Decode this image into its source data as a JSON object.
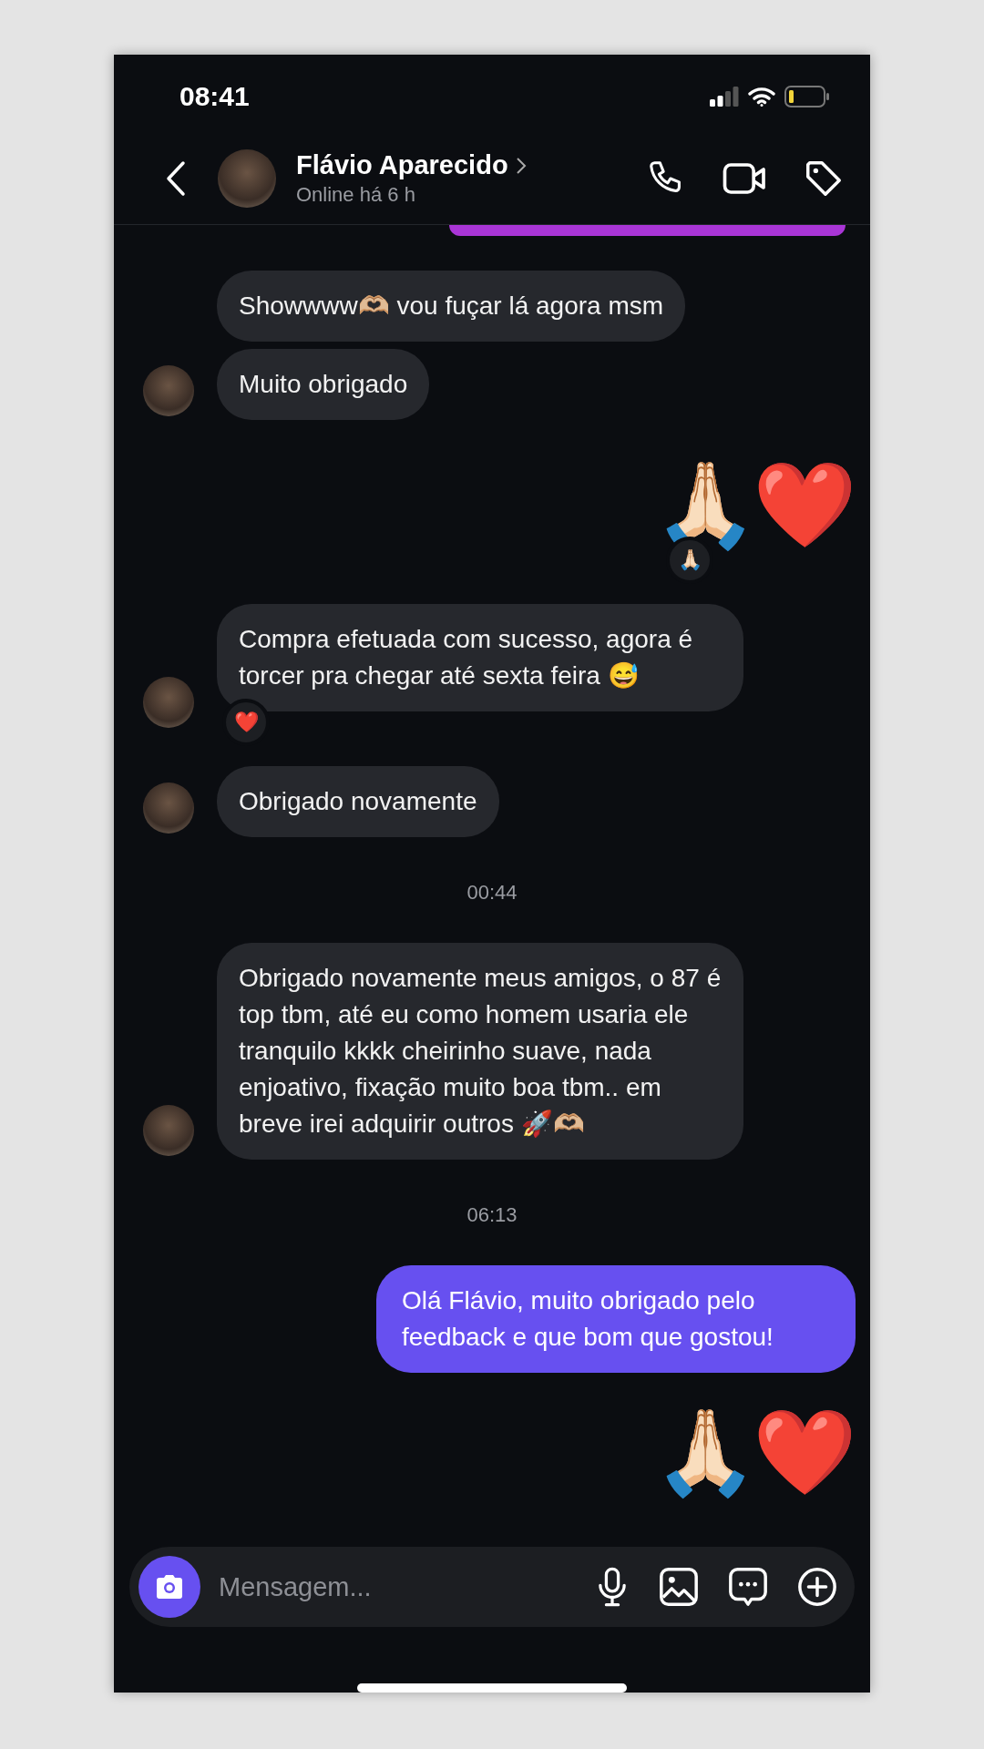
{
  "status_bar": {
    "time": "08:41"
  },
  "header": {
    "name": "Flávio Aparecido",
    "subtitle": "Online há 6 h"
  },
  "messages": [
    {
      "kind": "outgoing_edge"
    },
    {
      "kind": "incoming",
      "text": "Showwww🫶🏼 vou fuçar lá agora msm",
      "avatar": false
    },
    {
      "kind": "incoming",
      "text": "Muito obrigado",
      "avatar": true
    },
    {
      "kind": "emoji_out",
      "text": "🙏🏻❤️",
      "reaction": "🙏🏻"
    },
    {
      "kind": "incoming",
      "text": "Compra efetuada com sucesso, agora é torcer pra chegar até sexta feira 😅",
      "avatar": true,
      "reaction": "❤️"
    },
    {
      "kind": "incoming",
      "text": "Obrigado novamente",
      "avatar": true
    },
    {
      "kind": "timestamp",
      "text": "00:44"
    },
    {
      "kind": "incoming",
      "text": "Obrigado novamente meus amigos, o 87 é top tbm, até eu como homem usaria ele tranquilo kkkk cheirinho suave, nada enjoativo, fixação muito boa tbm.. em breve irei adquirir outros 🚀🫶🏼",
      "avatar": true
    },
    {
      "kind": "timestamp",
      "text": "06:13"
    },
    {
      "kind": "outgoing",
      "text": "Olá Flávio, muito obrigado pelo feedback e que bom que gostou!"
    },
    {
      "kind": "emoji_out",
      "text": "🙏🏻❤️"
    }
  ],
  "composer": {
    "placeholder": "Mensagem..."
  }
}
